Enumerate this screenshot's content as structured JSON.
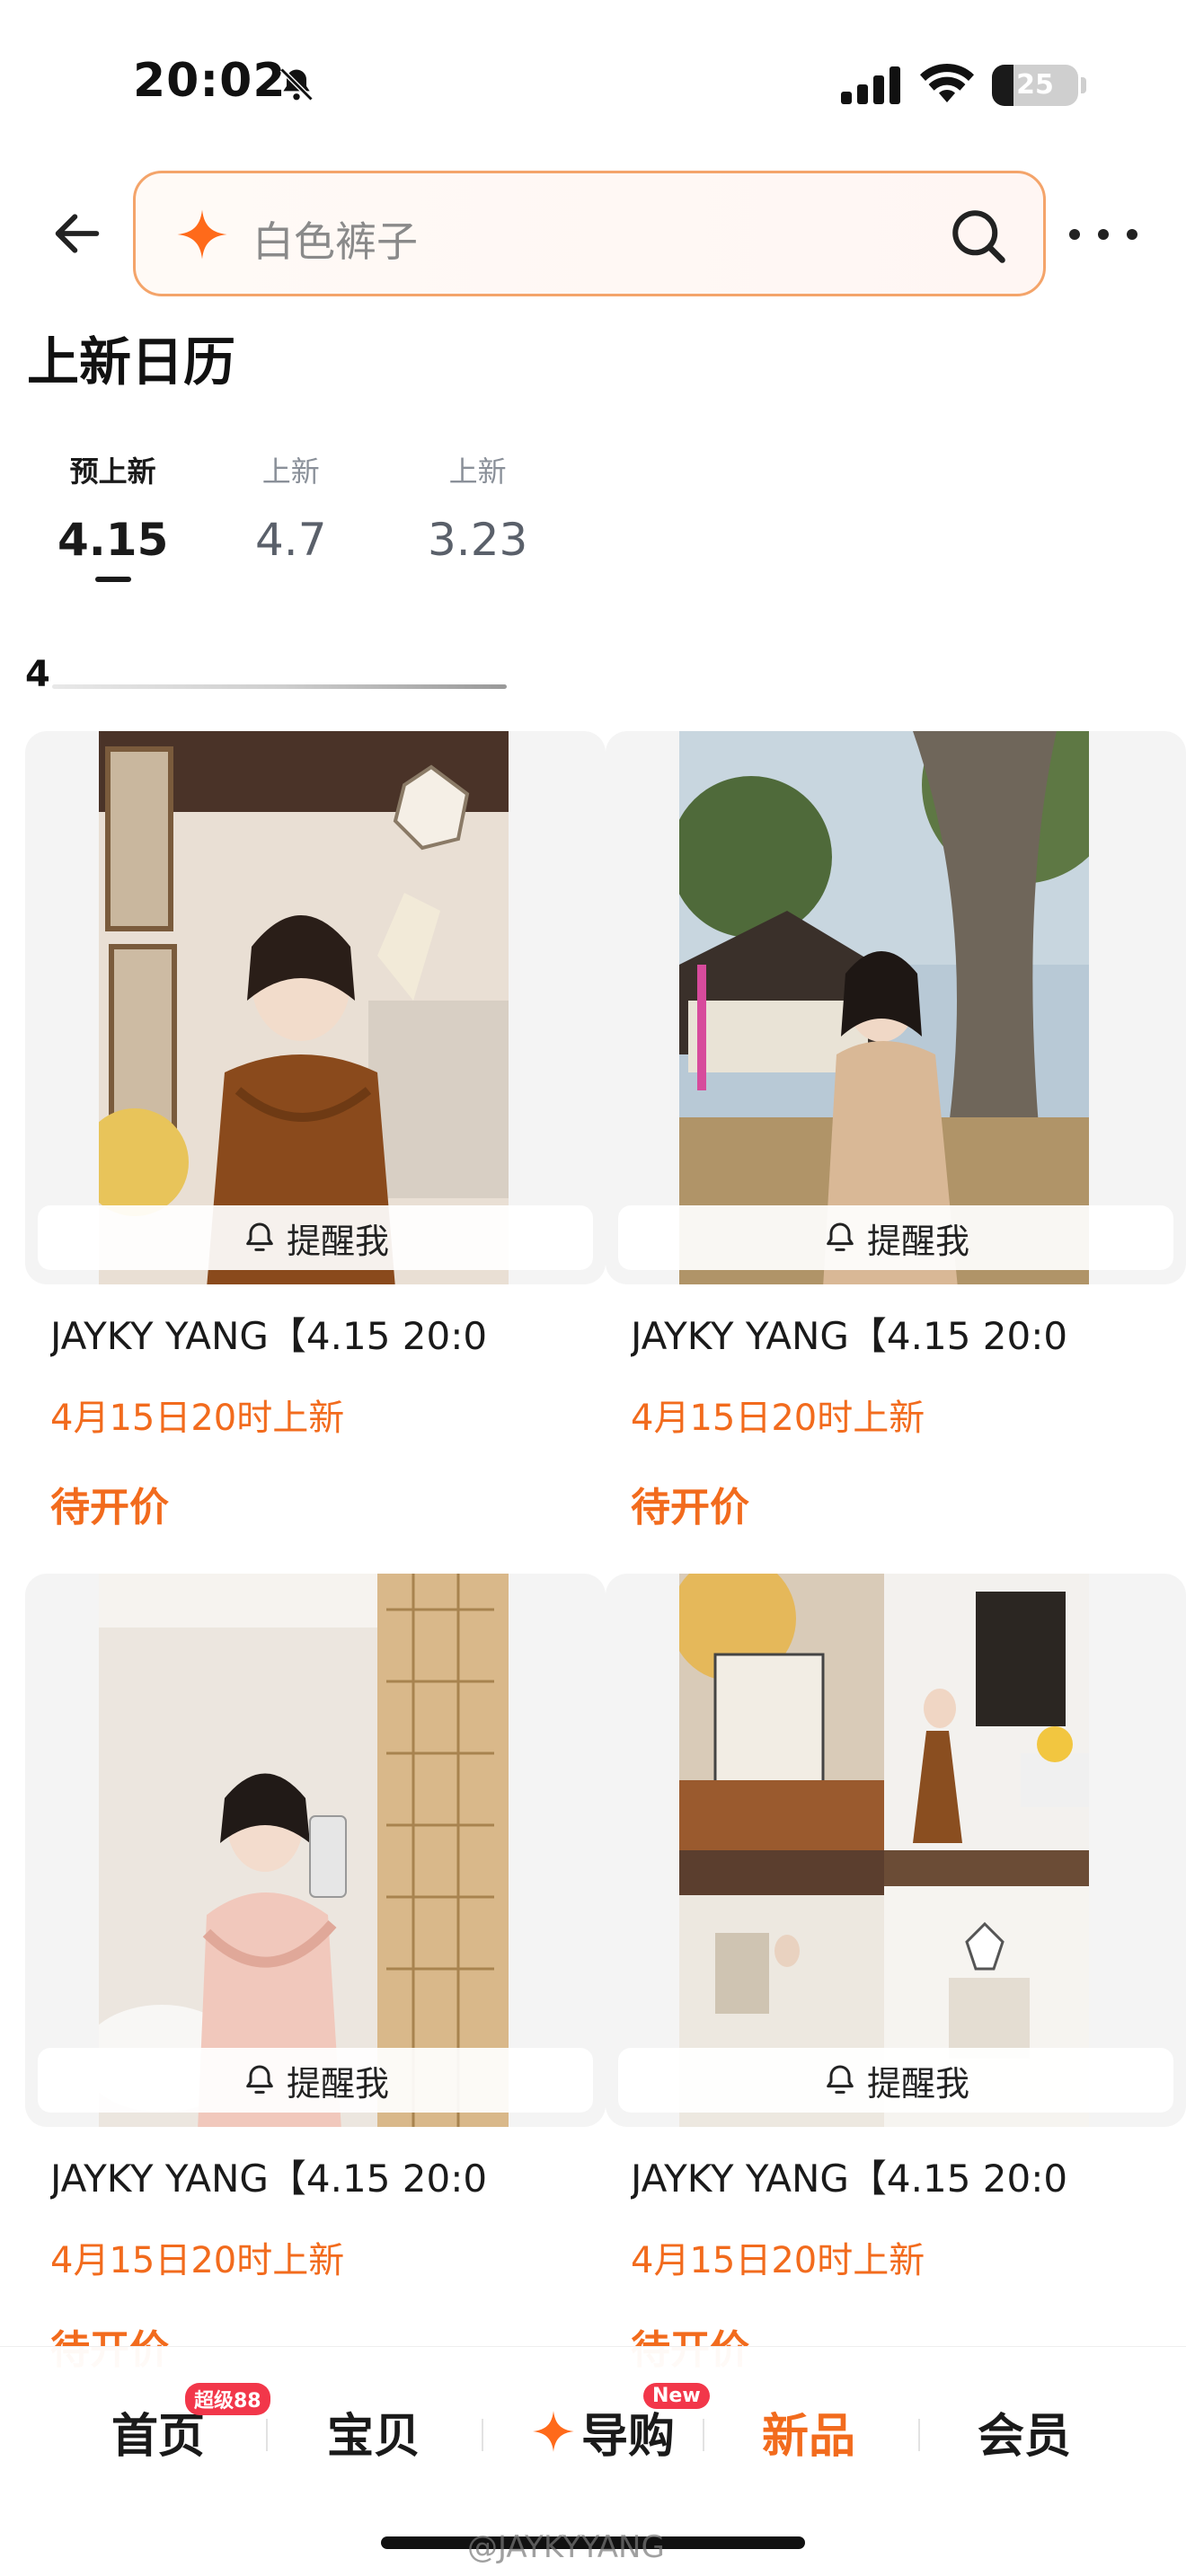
{
  "status_bar": {
    "time": "20:02",
    "battery": "25",
    "battery_level": 0.25
  },
  "search": {
    "placeholder": "白色裤子"
  },
  "page": {
    "title": "上新日历",
    "section_marker": "4"
  },
  "date_tabs": [
    {
      "label": "预上新",
      "date": "4.15",
      "active": true
    },
    {
      "label": "上新",
      "date": "4.7",
      "active": false
    },
    {
      "label": "上新",
      "date": "3.23",
      "active": false
    }
  ],
  "products": [
    {
      "remind_label": "提醒我",
      "title": "JAYKY YANG【4.15 20:0",
      "subtitle": "4月15日20时上新",
      "price": "待开价"
    },
    {
      "remind_label": "提醒我",
      "title": "JAYKY YANG【4.15 20:0",
      "subtitle": "4月15日20时上新",
      "price": "待开价"
    },
    {
      "remind_label": "提醒我",
      "title": "JAYKY YANG【4.15 20:0",
      "subtitle": "4月15日20时上新",
      "price": "待开价"
    },
    {
      "remind_label": "提醒我",
      "title": "JAYKY YANG【4.15 20:0",
      "subtitle": "4月15日20时上新",
      "price": "待开价"
    }
  ],
  "bottom_nav": [
    {
      "label": "首页",
      "badge": "超级88"
    },
    {
      "label": "宝贝",
      "badge": ""
    },
    {
      "label": "导购",
      "badge": "New"
    },
    {
      "label": "新品",
      "badge": "",
      "active": true
    },
    {
      "label": "会员",
      "badge": ""
    }
  ],
  "watermark": "@JAYKYYANG",
  "colors": {
    "accent": "#f26b1d",
    "badge": "#f2374a",
    "search_border": "#f4a46a"
  }
}
